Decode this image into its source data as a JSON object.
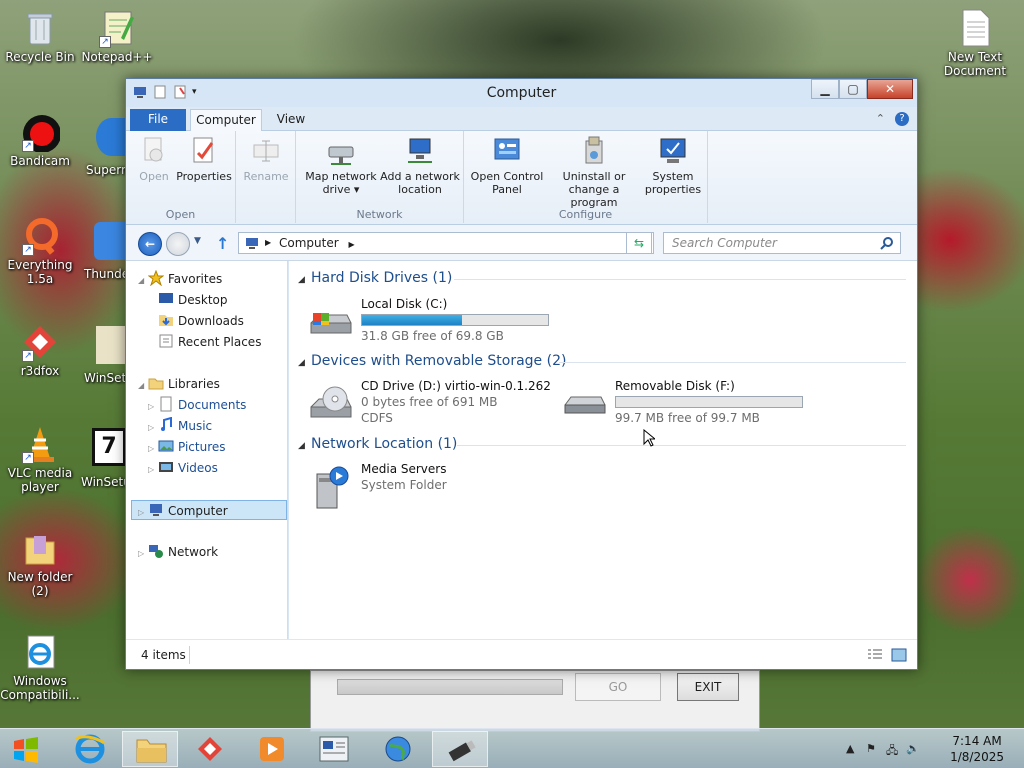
{
  "desktop": {
    "icons": [
      {
        "label1": "Recycle Bin",
        "label2": ""
      },
      {
        "label1": "Notepad++",
        "label2": ""
      },
      {
        "label1": "Bandicam",
        "label2": ""
      },
      {
        "label1": "Everything",
        "label2": "1.5a"
      },
      {
        "label1": "r3dfox",
        "label2": ""
      },
      {
        "label1": "VLC media",
        "label2": "player"
      },
      {
        "label1": "New folder",
        "label2": "(2)"
      },
      {
        "label1": "Windows",
        "label2": "Compatibili..."
      },
      {
        "label1": "New Text",
        "label2": "Document"
      }
    ],
    "partial_labels": [
      "Supern",
      "Thunde",
      "WinSetu",
      "WinSetu"
    ]
  },
  "window": {
    "title": "Computer",
    "tabs": [
      "File",
      "Computer",
      "View"
    ]
  },
  "ribbon": {
    "groups": [
      {
        "label": "Open",
        "buttons": [
          "Open",
          "Properties"
        ]
      },
      {
        "label": "",
        "buttons": [
          "Rename"
        ]
      },
      {
        "label": "Network",
        "buttons": [
          "Map network drive ▾",
          "Add a network location"
        ]
      },
      {
        "label": "Configure",
        "buttons": [
          "Open Control Panel",
          "Uninstall or change a program",
          "System properties"
        ]
      }
    ]
  },
  "address": {
    "path": "Computer",
    "search_placeholder": "Search Computer"
  },
  "nav": {
    "favorites": "Favorites",
    "desktop": "Desktop",
    "downloads": "Downloads",
    "recent": "Recent Places",
    "libraries": "Libraries",
    "documents": "Documents",
    "music": "Music",
    "pictures": "Pictures",
    "videos": "Videos",
    "computer": "Computer",
    "network": "Network"
  },
  "groups": {
    "hdd": {
      "header": "Hard Disk Drives (1)"
    },
    "removable": {
      "header": "Devices with Removable Storage (2)"
    },
    "network": {
      "header": "Network Location (1)"
    }
  },
  "drives": {
    "c": {
      "name": "Local Disk (C:)",
      "free": "31.8 GB free of 69.8 GB",
      "used_fraction": 0.54
    },
    "d": {
      "name": "CD Drive (D:) virtio-win-0.1.262",
      "free": "0 bytes free of 691 MB",
      "fs": "CDFS"
    },
    "f": {
      "name": "Removable Disk (F:)",
      "free": "99.7 MB free of 99.7 MB",
      "used_fraction": 0.0
    },
    "media": {
      "name": "Media Servers",
      "type": "System Folder"
    }
  },
  "status": {
    "items": "4 items"
  },
  "bgapp": {
    "go": "GO",
    "exit": "EXIT"
  },
  "clock": {
    "time": "7:14 AM",
    "date": "1/8/2025"
  },
  "colors": {
    "accent": "#2b6cc4",
    "selection": "#cde6f7",
    "progress": "#26a0da",
    "close": "#c7432a"
  }
}
